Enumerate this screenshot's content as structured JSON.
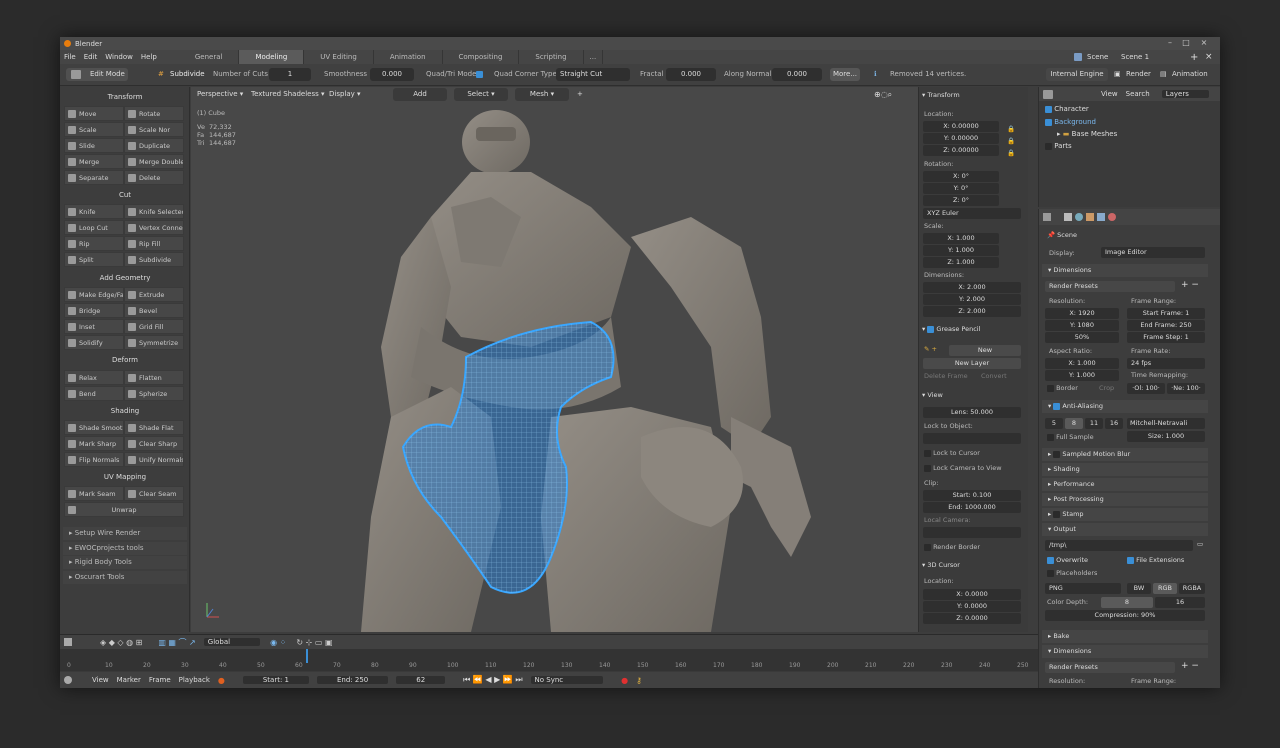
{
  "app_title": "Blender",
  "menu": [
    "File",
    "Edit",
    "Window",
    "Help"
  ],
  "workspaces": [
    {
      "label": "General",
      "active": false
    },
    {
      "label": "Modeling",
      "active": true
    },
    {
      "label": "UV Editing",
      "active": false
    },
    {
      "label": "Animation",
      "active": false
    },
    {
      "label": "Compositing",
      "active": false
    },
    {
      "label": "Scripting",
      "active": false
    },
    {
      "label": "...",
      "active": false
    }
  ],
  "scene_label": "Scene",
  "scene_value": "Scene 1",
  "opbar": {
    "mode": "Edit Mode",
    "operator": "Subdivide",
    "cuts_label": "Number of Cuts",
    "cuts_value": "1",
    "smooth_label": "Smoothness",
    "smooth_value": "0.000",
    "quad_label": "Quad/Tri Mode",
    "corner_label": "Quad Corner Type",
    "corner_value": "Straight Cut",
    "fractal_label": "Fractal",
    "fractal_value": "0.000",
    "along_label": "Along Normal",
    "along_value": "0.000",
    "more_label": "More...",
    "info": "Removed 14 vertices.",
    "engine": "Internal Engine",
    "render": "Render",
    "animation": "Animation"
  },
  "toolshelf": {
    "transform": "Transform",
    "move": "Move",
    "rotate": "Rotate",
    "scale": "Scale",
    "scale_nor": "Scale Nor",
    "slide": "Slide",
    "duplicate": "Duplicate",
    "merge": "Merge",
    "merge_doubles": "Merge Doubles",
    "separate": "Separate",
    "delete": "Delete",
    "cut": "Cut",
    "knife": "Knife",
    "knife_selected": "Knife Selected",
    "loop_cut": "Loop Cut",
    "vertex_connect": "Vertex Connect",
    "rip": "Rip",
    "rip_fill": "Rip Fill",
    "split": "Split",
    "subdivide": "Subdivide",
    "add_geometry": "Add Geometry",
    "make_edge": "Make Edge/Fac",
    "extrude": "Extrude",
    "bridge": "Bridge",
    "bevel": "Bevel",
    "inset": "Inset",
    "grid_fill": "Grid Fill",
    "solidify": "Solidify",
    "symmetrize": "Symmetrize",
    "deform": "Deform",
    "relax": "Relax",
    "flatten": "Flatten",
    "bend": "Bend",
    "spherize": "Spherize",
    "shading": "Shading",
    "shade_smooth": "Shade Smooth",
    "shade_flat": "Shade Flat",
    "mark_sharp": "Mark Sharp",
    "clear_sharp": "Clear Sharp",
    "flip_normals": "Flip Normals",
    "unify_normals": "Unify Normals",
    "uv_mapping": "UV Mapping",
    "mark_seam": "Mark Seam",
    "clear_seam": "Clear Seam",
    "unwrap": "Unwrap",
    "panels": [
      "Setup Wire Render",
      "EWOCprojects tools",
      "Rigid Body Tools",
      "Oscurart Tools"
    ]
  },
  "viewport": {
    "perspective": "Perspective",
    "shading": "Textured Shadeless",
    "display": "Display",
    "add": "Add",
    "select": "Select",
    "mesh": "Mesh",
    "object_name": "(1) Cube",
    "stats": [
      {
        "k": "Ve",
        "v": "72,332"
      },
      {
        "k": "Fa",
        "v": "144,687"
      },
      {
        "k": "Tri",
        "v": "144,687"
      }
    ]
  },
  "npanel": {
    "transform": "Transform",
    "location": "Location:",
    "loc": [
      "X: 0.00000",
      "Y: 0.00000",
      "Z: 0.00000"
    ],
    "rotation": "Rotation:",
    "rot": [
      "X: 0°",
      "Y: 0°",
      "Z: 0°"
    ],
    "euler": "XYZ Euler",
    "scale": "Scale:",
    "scl": [
      "X: 1.000",
      "Y: 1.000",
      "Z: 1.000"
    ],
    "dimensions": "Dimensions:",
    "dim": [
      "X: 2.000",
      "Y: 2.000",
      "Z: 2.000"
    ],
    "grease_pencil": "Grease Pencil",
    "new": "New",
    "new_layer": "New Layer",
    "delete_frame": "Delete Frame",
    "convert": "Convert",
    "view": "View",
    "lens": "Lens: 50.000",
    "lock_object": "Lock to Object:",
    "lock_cursor": "Lock to Cursor",
    "lock_camera": "Lock Camera to View",
    "clip": "Clip:",
    "clip_start": "Start: 0.100",
    "clip_end": "End: 1000.000",
    "local_camera": "Local Camera:",
    "render_border": "Render Border",
    "cursor": "3D Cursor",
    "cursor_location": "Location:",
    "cur": [
      "X: 0.0000",
      "Y: 0.0000",
      "Z: 0.0000"
    ]
  },
  "outliner": {
    "view": "View",
    "search": "Search",
    "layers": "Layers",
    "items": [
      {
        "label": "Character",
        "indent": 0
      },
      {
        "label": "Background",
        "indent": 0
      },
      {
        "label": "Base Meshes",
        "indent": 2
      },
      {
        "label": "Parts",
        "indent": 0
      }
    ]
  },
  "props": {
    "scene": "Scene",
    "display_label": "Display:",
    "display_value": "Image Editor",
    "dimensions": "Dimensions",
    "render_presets": "Render Presets",
    "resolution": "Resolution:",
    "res_x": "X: 1920",
    "res_y": "Y: 1080",
    "res_pct": "50%",
    "frame_range": "Frame Range:",
    "start_frame": "Start Frame: 1",
    "end_frame": "End Frame: 250",
    "frame_step": "Frame Step: 1",
    "aspect": "Aspect Ratio:",
    "asp_x": "X: 1.000",
    "asp_y": "Y: 1.000",
    "frame_rate": "Frame Rate:",
    "fps": "24 fps",
    "time_remap": "Time Remapping:",
    "old": "·Ol: 100·",
    "ne": "·Ne: 100·",
    "border": "Border",
    "crop": "Crop",
    "anti_aliasing": "Anti-Aliasing",
    "aa_samples": [
      "5",
      "8",
      "11",
      "16"
    ],
    "aa_filter": "Mitchell-Netravali",
    "full_sample": "Full Sample",
    "size": "Size: 1.000",
    "motion_blur": "Sampled Motion Blur",
    "shading": "Shading",
    "performance": "Performance",
    "post_processing": "Post Processing",
    "stamp": "Stamp",
    "output": "Output",
    "path": "/tmp\\",
    "overwrite": "Overwrite",
    "file_ext": "File Extensions",
    "placeholders": "Placeholders",
    "format": "PNG",
    "bw": "BW",
    "rgb": "RGB",
    "rgba": "RGBA",
    "color_depth": "Color Depth:",
    "depth8": "8",
    "depth16": "16",
    "compression": "Compression: 90%",
    "bake": "Bake",
    "dimensions2": "Dimensions",
    "render_presets2": "Render Presets",
    "resolution2": "Resolution:",
    "frame_range2": "Frame Range:"
  },
  "header3d": {
    "global": "Global"
  },
  "timeline": {
    "ticks": [
      "0",
      "10",
      "20",
      "30",
      "40",
      "50",
      "60",
      "70",
      "80",
      "90",
      "100",
      "110",
      "120",
      "130",
      "140",
      "150",
      "160",
      "170",
      "180",
      "190",
      "200",
      "210",
      "220",
      "230",
      "240",
      "250"
    ],
    "current_frame": 62,
    "view": "View",
    "marker": "Marker",
    "frame": "Frame",
    "playback": "Playback",
    "start": "Start: 1",
    "end": "End: 250",
    "frame_value": "62",
    "sync": "No Sync"
  },
  "colors": {
    "accent": "#3a8fd6",
    "mesh_highlight": "#38a6ff",
    "model_gray": "#8a847c"
  }
}
